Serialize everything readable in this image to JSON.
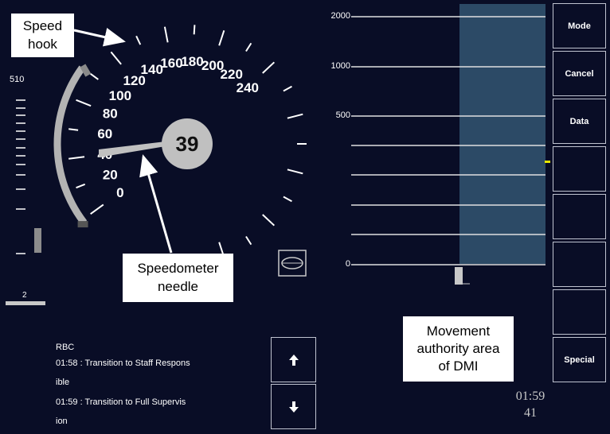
{
  "callouts": {
    "speed_hook": "Speed\nhook",
    "needle": "Speedometer\nneedle",
    "ma_area": "Movement\nauthority area\nof DMI"
  },
  "left_scale": {
    "top_label": "510",
    "bottom_label": "2"
  },
  "speedometer": {
    "current_speed": "39",
    "labels": [
      "0",
      "20",
      "40",
      "60",
      "80",
      "100",
      "120",
      "140",
      "160",
      "180",
      "200",
      "220",
      "240"
    ]
  },
  "distance_scale": {
    "labels": [
      "2000",
      "1000",
      "500",
      "0"
    ]
  },
  "softkeys": {
    "mode": "Mode",
    "cancel": "Cancel",
    "data": "Data",
    "special": "Special"
  },
  "messages": {
    "header": "RBC",
    "items": [
      {
        "time": "01:58",
        "text_line1": ": Transition to Staff Respons",
        "text_line2": "ible"
      },
      {
        "time": "01:59",
        "text_line1": ": Transition to Full Supervis",
        "text_line2": "ion"
      }
    ]
  },
  "clock": {
    "hhmm": "01:59",
    "ss": "41"
  },
  "colors": {
    "background": "#090d26",
    "ma_area": "#2c4a66",
    "hook": "#b9b9b9",
    "needle": "#c0c0c0",
    "marker": "#e6e600"
  },
  "icons": {
    "mode_symbol": "staff-responsible-eye-icon",
    "scroll_up": "arrow-up-icon",
    "scroll_down": "arrow-down-icon"
  }
}
